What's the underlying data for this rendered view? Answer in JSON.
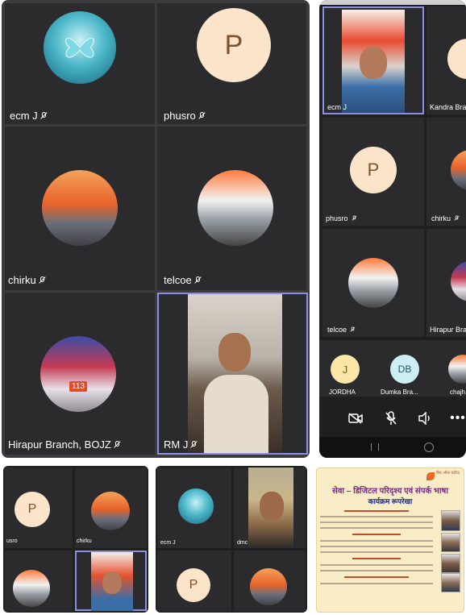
{
  "main_grid": {
    "tiles": [
      {
        "name": "ecm J",
        "avatar": "image"
      },
      {
        "name": "phusro",
        "avatar": "P"
      },
      {
        "name": "chirku",
        "avatar": "image"
      },
      {
        "name": "telcoe",
        "avatar": "image"
      },
      {
        "name": "Hirapur Branch, BOJZ",
        "avatar": "image"
      },
      {
        "name": "RM J",
        "avatar": "video"
      }
    ]
  },
  "phone": {
    "tiles": [
      {
        "name": "ecm J"
      },
      {
        "name": "Kandra Bra"
      },
      {
        "name": "phusro",
        "avatar": "P"
      },
      {
        "name": "chirku"
      },
      {
        "name": "telcoe"
      },
      {
        "name": "Hirapur Bra"
      }
    ],
    "strip": [
      {
        "name": "JORDHA",
        "initials": "J"
      },
      {
        "name": "Dumka Bra...",
        "initials": "DB"
      },
      {
        "name": "chajh"
      }
    ],
    "controls": [
      "camera-off",
      "mic-off",
      "speaker",
      "more"
    ]
  },
  "bottom_left": {
    "tiles": [
      {
        "name": "usro",
        "avatar": "P"
      },
      {
        "name": "chirku"
      }
    ]
  },
  "bottom_mid": {
    "tiles": [
      {
        "name": "ecm J"
      },
      {
        "name": "dmc"
      }
    ],
    "avatar_letter": "P"
  },
  "document": {
    "header_small": "बैंक ऑफ़ बड़ौदा",
    "title": "सेवा – डिजिटल परिदृश्य एवं संपर्क भाषा",
    "subtitle": "कार्यक्रम रूपरेखा"
  },
  "colors": {
    "panel": "#3b3a3d",
    "tile": "#2b2a2c",
    "active_outline": "#8a8ee6",
    "avatar_bg": "#fbe4c9",
    "initials_bg": "#fde7a8",
    "doc_bg": "#f8edc7"
  }
}
